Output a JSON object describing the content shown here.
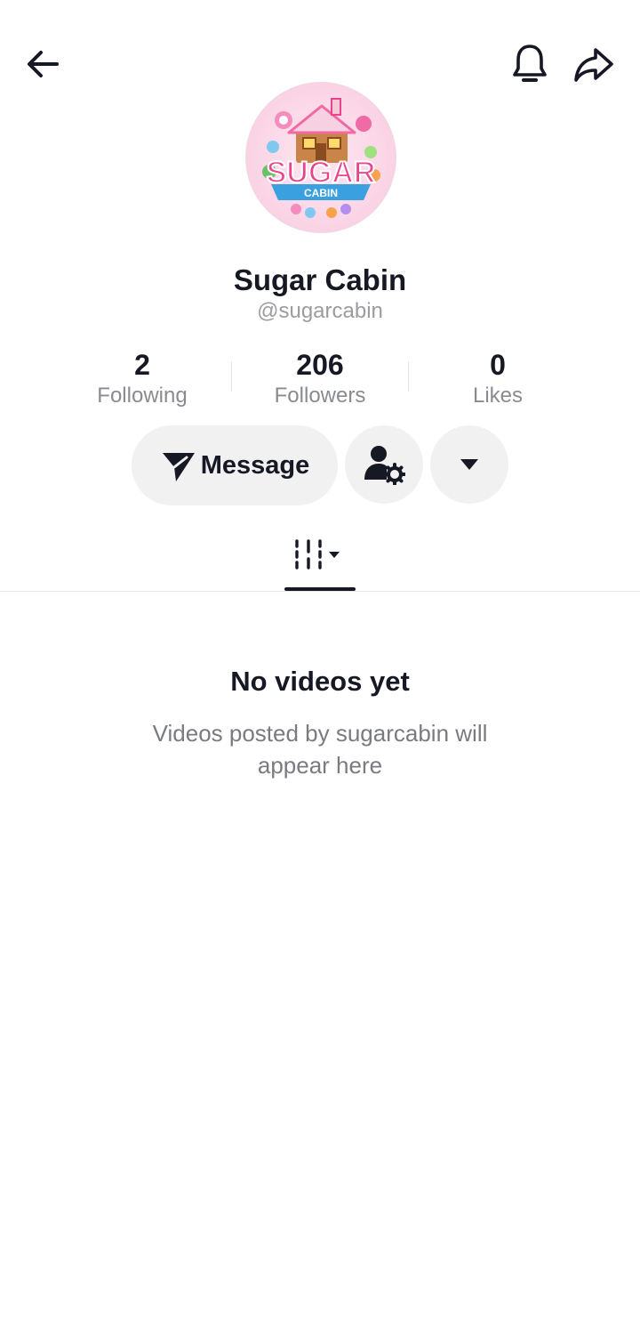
{
  "header": {
    "back_icon": "arrow-left-icon",
    "notify_icon": "bell-icon",
    "share_icon": "share-arrow-icon"
  },
  "profile": {
    "avatar_text_top": "SUGAR",
    "avatar_text_bottom": "CABIN",
    "display_name": "Sugar Cabin",
    "username": "@sugarcabin"
  },
  "stats": [
    {
      "value": "2",
      "label": "Following"
    },
    {
      "value": "206",
      "label": "Followers"
    },
    {
      "value": "0",
      "label": "Likes"
    }
  ],
  "actions": {
    "message_label": "Message",
    "message_icon": "send-icon",
    "follow_settings_icon": "user-gear-icon",
    "dropdown_icon": "caret-down-icon"
  },
  "tabs": {
    "videos_icon": "grid-sort-icon"
  },
  "empty_state": {
    "title": "No videos yet",
    "subtitle": "Videos posted by sugarcabin will appear here"
  },
  "colors": {
    "text_primary": "#161823",
    "text_secondary": "#8a8b91",
    "button_bg": "#f1f1f2",
    "avatar_pink": "#e8468c",
    "avatar_blue": "#3aa0e0"
  }
}
